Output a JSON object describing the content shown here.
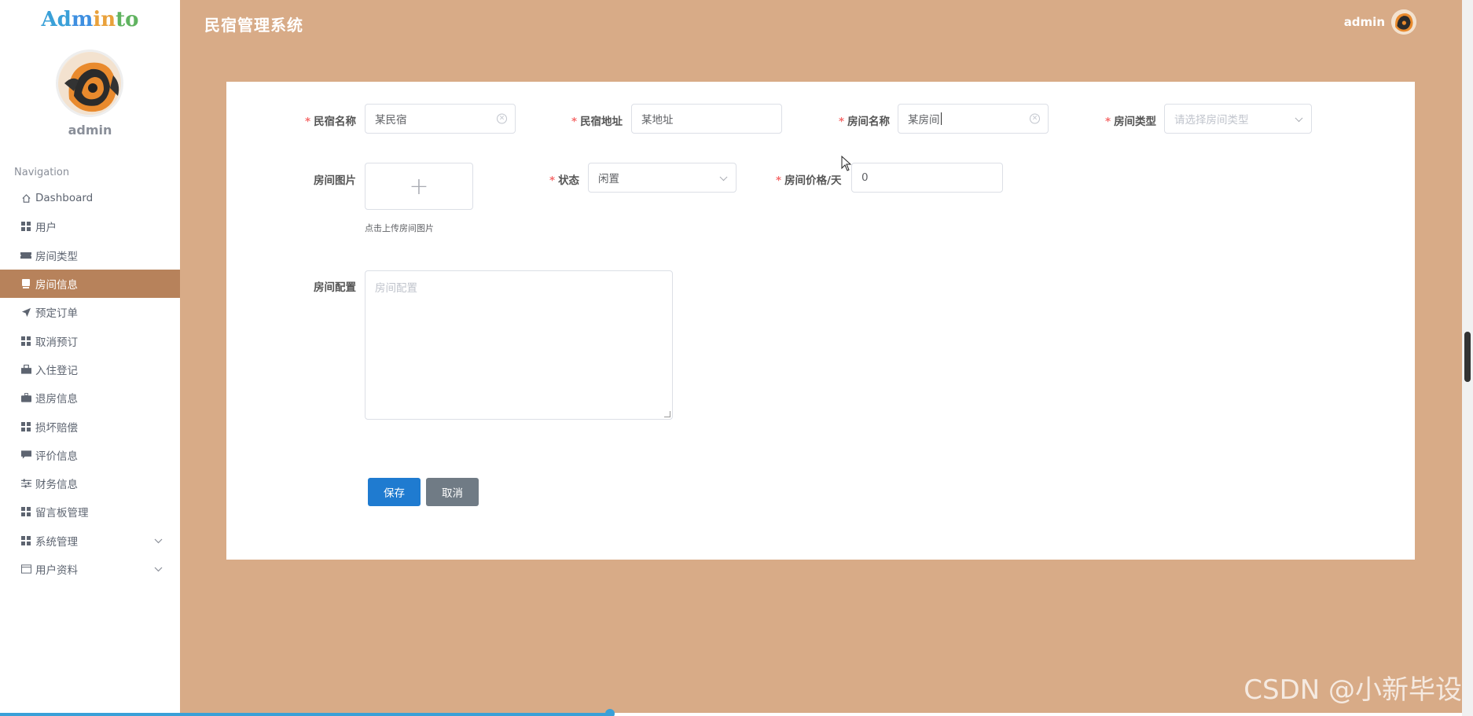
{
  "logo": {
    "part1": "Ad",
    "part2": "m",
    "part3": "in",
    "part4": "to"
  },
  "sidebar": {
    "user_name": "admin",
    "nav_title": "Navigation",
    "items": [
      {
        "label": "Dashboard",
        "icon": "home-icon"
      },
      {
        "label": "用户",
        "icon": "grid-icon"
      },
      {
        "label": "房间类型",
        "icon": "ticket-icon"
      },
      {
        "label": "房间信息",
        "icon": "card-icon",
        "active": true
      },
      {
        "label": "预定订单",
        "icon": "paper-plane-icon"
      },
      {
        "label": "取消预订",
        "icon": "grid-icon"
      },
      {
        "label": "入住登记",
        "icon": "bag-icon"
      },
      {
        "label": "退房信息",
        "icon": "briefcase-icon"
      },
      {
        "label": "损坏赔偿",
        "icon": "grid-icon"
      },
      {
        "label": "评价信息",
        "icon": "comment-icon"
      },
      {
        "label": "财务信息",
        "icon": "sliders-icon"
      },
      {
        "label": "留言板管理",
        "icon": "grid-icon"
      },
      {
        "label": "系统管理",
        "icon": "grid-icon",
        "expandable": true
      },
      {
        "label": "用户资料",
        "icon": "window-icon",
        "expandable": true
      }
    ]
  },
  "header": {
    "title": "民宿管理系统",
    "user": "admin"
  },
  "form": {
    "homestay_name": {
      "label": "民宿名称",
      "value": "某民宿"
    },
    "homestay_address": {
      "label": "民宿地址",
      "value": "某地址"
    },
    "room_name": {
      "label": "房间名称",
      "value": "某房间"
    },
    "room_type": {
      "label": "房间类型",
      "placeholder": "请选择房间类型"
    },
    "room_image": {
      "label": "房间图片",
      "hint": "点击上传房间图片"
    },
    "status": {
      "label": "状态",
      "value": "闲置"
    },
    "price": {
      "label": "房间价格/天",
      "value": "0"
    },
    "config": {
      "label": "房间配置",
      "placeholder": "房间配置"
    },
    "save_label": "保存",
    "cancel_label": "取消"
  },
  "watermark": "CSDN @小新毕设",
  "colors": {
    "background": "#d8ab87",
    "active_nav": "#b7825b",
    "primary": "#1f7bd0",
    "secondary": "#707b85",
    "required": "#f56c6c"
  }
}
